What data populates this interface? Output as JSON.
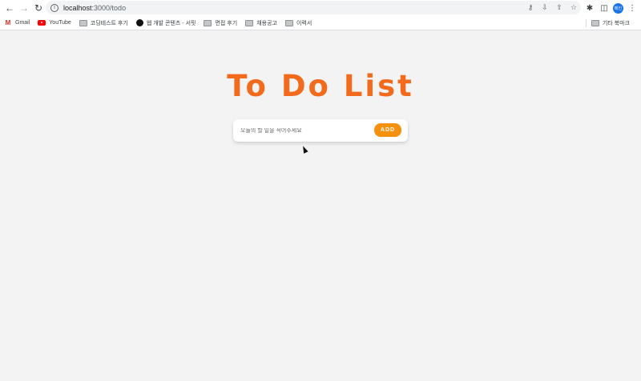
{
  "browser": {
    "url_host": "localhost",
    "url_rest": ":3000/todo",
    "profile_label": "메인"
  },
  "bookmarks": [
    {
      "label": "Gmail",
      "icon": "gmail-icon"
    },
    {
      "label": "YouTube",
      "icon": "youtube-icon"
    },
    {
      "label": "코딩테스트 후기",
      "icon": "folder-icon"
    },
    {
      "label": "웹 개발 콘텐츠 - 서핏",
      "icon": "site-icon"
    },
    {
      "label": "면접 후기",
      "icon": "folder-icon"
    },
    {
      "label": "채용공고",
      "icon": "folder-icon"
    },
    {
      "label": "이력서",
      "icon": "folder-icon"
    }
  ],
  "bookmarks_other": "기타 북마크",
  "app": {
    "title": "To Do List",
    "input_placeholder": "오늘의 할 일을 적어주세요",
    "add_label": "ADD"
  },
  "colors": {
    "title": "#f26b1d",
    "add_button": "#f5910d",
    "background": "#f3f3f3"
  }
}
